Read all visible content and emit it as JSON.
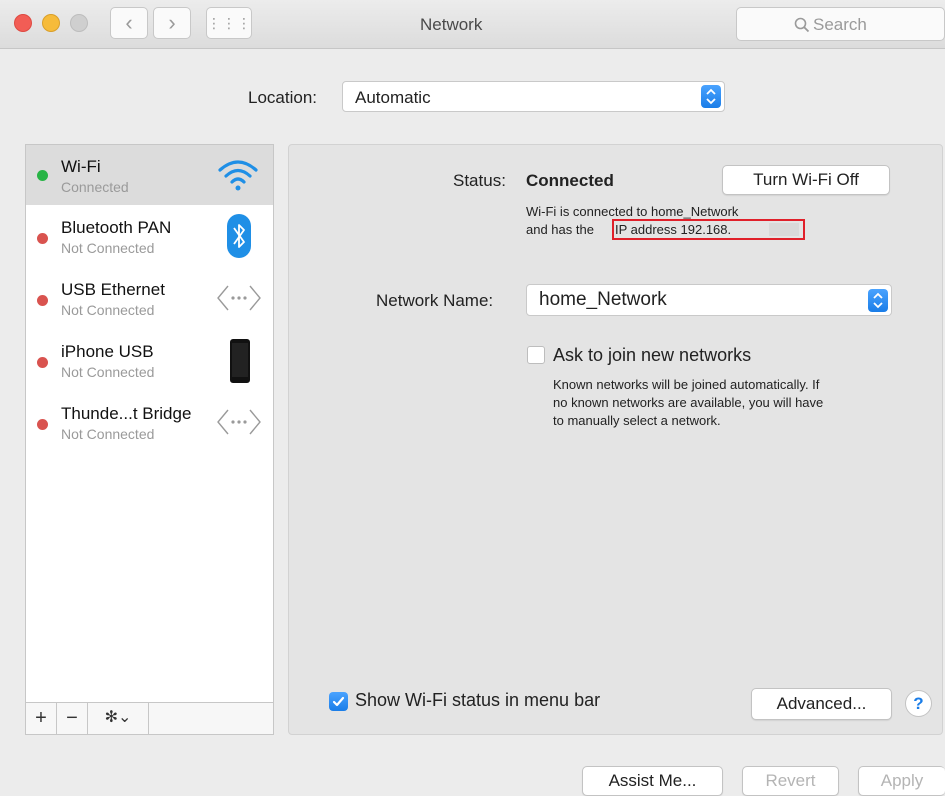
{
  "window": {
    "title": "Network",
    "search_placeholder": "Search",
    "nav_back": "‹",
    "nav_forward": "›",
    "grid": "⋮⋮⋮"
  },
  "location": {
    "label": "Location:",
    "value": "Automatic"
  },
  "sidebar": {
    "items": [
      {
        "name": "Wi-Fi",
        "status": "Connected",
        "dot": "#28b446",
        "icon": "wifi-icon",
        "selected": true
      },
      {
        "name": "Bluetooth PAN",
        "status": "Not Connected",
        "dot": "#d9534f",
        "icon": "bluetooth-icon"
      },
      {
        "name": "USB Ethernet",
        "status": "Not Connected",
        "dot": "#d9534f",
        "icon": "ethernet-icon"
      },
      {
        "name": "iPhone USB",
        "status": "Not Connected",
        "dot": "#d9534f",
        "icon": "iphone-icon"
      },
      {
        "name": "Thunde...t Bridge",
        "status": "Not Connected",
        "dot": "#d9534f",
        "icon": "ethernet-icon"
      }
    ],
    "tools": {
      "add": "+",
      "remove": "−",
      "gear": "✻⌄"
    }
  },
  "main": {
    "status_label": "Status:",
    "status_value": "Connected",
    "turn_off_button": "Turn Wi-Fi Off",
    "status_desc_line1": "Wi-Fi is connected to home_Network",
    "status_desc_line2_prefix": "and has the",
    "ip_text": "IP address 192.168.",
    "network_name_label": "Network Name:",
    "network_name_value": "home_Network",
    "ask_join_label": "Ask to join new networks",
    "ask_join_checked": false,
    "ask_join_desc": [
      "Known networks will be joined automatically. If",
      "no known networks are available, you will have",
      "to manually select a network."
    ],
    "show_menu_bar_label": "Show Wi-Fi status in menu bar",
    "show_menu_bar_checked": true,
    "advanced_button": "Advanced...",
    "help_button": "?"
  },
  "footer": {
    "assist_button": "Assist Me...",
    "revert_button": "Revert",
    "apply_button": "Apply"
  },
  "colors": {
    "accent": "#1a7de8",
    "highlight_box": "#e0202a"
  }
}
